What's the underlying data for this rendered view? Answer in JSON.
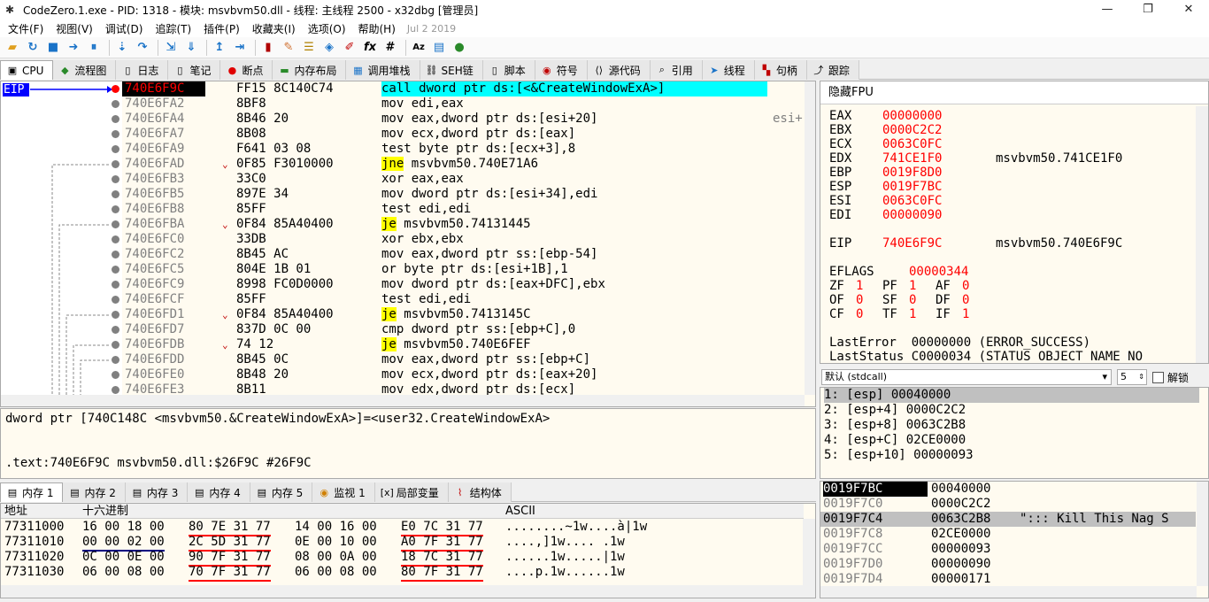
{
  "window": {
    "title": "CodeZero.1.exe - PID: 1318 - 模块: msvbvm50.dll - 线程: 主线程 2500 - x32dbg [管理员]",
    "min": "—",
    "max": "❐",
    "close": "✕"
  },
  "menu": [
    "文件(F)",
    "视图(V)",
    "调试(D)",
    "追踪(T)",
    "插件(P)",
    "收藏夹(I)",
    "选项(O)",
    "帮助(H)"
  ],
  "menu_date": "Jul 2 2019",
  "tabs": [
    {
      "label": "CPU",
      "icon": "cpu-icon"
    },
    {
      "label": "流程图",
      "icon": "graph-icon"
    },
    {
      "label": "日志",
      "icon": "log-icon"
    },
    {
      "label": "笔记",
      "icon": "notes-icon"
    },
    {
      "label": "断点",
      "icon": "breakpoint-icon"
    },
    {
      "label": "内存布局",
      "icon": "memory-map-icon"
    },
    {
      "label": "调用堆栈",
      "icon": "callstack-icon"
    },
    {
      "label": "SEH链",
      "icon": "seh-icon"
    },
    {
      "label": "脚本",
      "icon": "script-icon"
    },
    {
      "label": "符号",
      "icon": "symbol-icon"
    },
    {
      "label": "源代码",
      "icon": "source-icon"
    },
    {
      "label": "引用",
      "icon": "references-icon"
    },
    {
      "label": "线程",
      "icon": "threads-icon"
    },
    {
      "label": "句柄",
      "icon": "handles-icon"
    },
    {
      "label": "跟踪",
      "icon": "trace-icon"
    }
  ],
  "eip_label": "EIP",
  "disasm": [
    {
      "addr": "740E6F9C",
      "bytes": "FF15 8C140C74",
      "mn": "call",
      "ops": " dword ptr ds:[<&CreateWindowExA>]",
      "cur": true
    },
    {
      "addr": "740E6FA2",
      "bytes": "8BF8",
      "mn": "mov",
      "ops": " edi,eax"
    },
    {
      "addr": "740E6FA4",
      "bytes": "8B46 20",
      "mn": "mov",
      "ops": " eax,dword ptr ds:[esi+20]"
    },
    {
      "addr": "740E6FA7",
      "bytes": "8B08",
      "mn": "mov",
      "ops": " ecx,dword ptr ds:[eax]"
    },
    {
      "addr": "740E6FA9",
      "bytes": "F641 03 08",
      "mn": "test",
      "ops": " byte ptr ds:[ecx+3],8"
    },
    {
      "addr": "740E6FAD",
      "bytes": "0F85 F3010000",
      "mn": "jne",
      "ops": " msvbvm50.740E71A6",
      "jmp": true
    },
    {
      "addr": "740E6FB3",
      "bytes": "33C0",
      "mn": "xor",
      "ops": " eax,eax"
    },
    {
      "addr": "740E6FB5",
      "bytes": "897E 34",
      "mn": "mov",
      "ops": " dword ptr ds:[esi+34],edi"
    },
    {
      "addr": "740E6FB8",
      "bytes": "85FF",
      "mn": "test",
      "ops": " edi,edi"
    },
    {
      "addr": "740E6FBA",
      "bytes": "0F84 85A40400",
      "mn": "je",
      "ops": " msvbvm50.74131445",
      "jmp": true
    },
    {
      "addr": "740E6FC0",
      "bytes": "33DB",
      "mn": "xor",
      "ops": " ebx,ebx"
    },
    {
      "addr": "740E6FC2",
      "bytes": "8B45 AC",
      "mn": "mov",
      "ops": " eax,dword ptr ss:[ebp-54]"
    },
    {
      "addr": "740E6FC5",
      "bytes": "804E 1B 01",
      "mn": "or",
      "ops": " byte ptr ds:[esi+1B],1"
    },
    {
      "addr": "740E6FC9",
      "bytes": "8998 FC0D0000",
      "mn": "mov",
      "ops": " dword ptr ds:[eax+DFC],ebx"
    },
    {
      "addr": "740E6FCF",
      "bytes": "85FF",
      "mn": "test",
      "ops": " edi,edi"
    },
    {
      "addr": "740E6FD1",
      "bytes": "0F84 85A40400",
      "mn": "je",
      "ops": " msvbvm50.7413145C",
      "jmp": true
    },
    {
      "addr": "740E6FD7",
      "bytes": "837D 0C 00",
      "mn": "cmp",
      "ops": " dword ptr ss:[ebp+C],0"
    },
    {
      "addr": "740E6FDB",
      "bytes": "74 12",
      "mn": "je",
      "ops": " msvbvm50.740E6FEF",
      "jmp": true
    },
    {
      "addr": "740E6FDD",
      "bytes": "8B45 0C",
      "mn": "mov",
      "ops": " eax,dword ptr ss:[ebp+C]"
    },
    {
      "addr": "740E6FE0",
      "bytes": "8B48 20",
      "mn": "mov",
      "ops": " ecx,dword ptr ds:[eax+20]"
    },
    {
      "addr": "740E6FE3",
      "bytes": "8B11",
      "mn": "mov",
      "ops": " edx,dword ptr ds:[ecx]"
    }
  ],
  "disasm_side_comment": "esi+",
  "info": {
    "line1": "dword ptr [740C148C <msvbvm50.&CreateWindowExA>]=<user32.CreateWindowExA>",
    "line2": ".text:740E6F9C msvbvm50.dll:$26F9C #26F9C"
  },
  "regs": {
    "header": "隐藏FPU",
    "gp": [
      {
        "n": "EAX",
        "v": "00000000",
        "c": ""
      },
      {
        "n": "EBX",
        "v": "0000C2C2",
        "c": ""
      },
      {
        "n": "ECX",
        "v": "0063C0FC",
        "c": ""
      },
      {
        "n": "EDX",
        "v": "741CE1F0",
        "c": "msvbvm50.741CE1F0"
      },
      {
        "n": "EBP",
        "v": "0019F8D0",
        "c": ""
      },
      {
        "n": "ESP",
        "v": "0019F7BC",
        "c": ""
      },
      {
        "n": "ESI",
        "v": "0063C0FC",
        "c": ""
      },
      {
        "n": "EDI",
        "v": "00000090",
        "c": ""
      }
    ],
    "eip": {
      "n": "EIP",
      "v": "740E6F9C",
      "c": "msvbvm50.740E6F9C"
    },
    "eflags": {
      "n": "EFLAGS",
      "v": "00000344"
    },
    "flags": [
      [
        {
          "n": "ZF",
          "v": "1"
        },
        {
          "n": "PF",
          "v": "1"
        },
        {
          "n": "AF",
          "v": "0"
        }
      ],
      [
        {
          "n": "OF",
          "v": "0"
        },
        {
          "n": "SF",
          "v": "0"
        },
        {
          "n": "DF",
          "v": "0"
        }
      ],
      [
        {
          "n": "CF",
          "v": "0"
        },
        {
          "n": "TF",
          "v": "1"
        },
        {
          "n": "IF",
          "v": "1"
        }
      ]
    ],
    "lasterror": "LastError  00000000 (ERROR_SUCCESS)",
    "laststatus": "LastStatus C0000034 (STATUS_OBJECT_NAME_NO"
  },
  "callconv": {
    "value": "默认 (stdcall)",
    "count": "5",
    "unlock_label": "解锁"
  },
  "args": [
    "1: [esp] 00040000",
    "2: [esp+4] 0000C2C2",
    "3: [esp+8] 0063C2B8",
    "4: [esp+C] 02CE0000",
    "5: [esp+10] 00000093"
  ],
  "memtabs": [
    {
      "label": "内存 1",
      "icon": "dump-icon"
    },
    {
      "label": "内存 2",
      "icon": "dump-icon"
    },
    {
      "label": "内存 3",
      "icon": "dump-icon"
    },
    {
      "label": "内存 4",
      "icon": "dump-icon"
    },
    {
      "label": "内存 5",
      "icon": "dump-icon"
    },
    {
      "label": "监视 1",
      "icon": "watch-icon"
    },
    {
      "label": "局部变量",
      "icon": "locals-icon"
    },
    {
      "label": "结构体",
      "icon": "struct-icon"
    }
  ],
  "dump": {
    "headers": {
      "addr": "地址",
      "hex": "十六进制",
      "ascii": "ASCII"
    },
    "rows": [
      {
        "addr": "77311000",
        "g": [
          "16 00 18 00",
          "80 7E 31 77",
          "14 00 16 00",
          "E0 7C 31 77"
        ],
        "ascii": "........~1w....à|1w"
      },
      {
        "addr": "77311010",
        "g": [
          "00 00 02 00",
          "2C 5D 31 77",
          "0E 00 10 00",
          "A0 7F 31 77"
        ],
        "ascii": "....,]1w.... .1w"
      },
      {
        "addr": "77311020",
        "g": [
          "0C 00 0E 00",
          "90 7F 31 77",
          "08 00 0A 00",
          "18 7C 31 77"
        ],
        "ascii": "......1w.....|1w"
      },
      {
        "addr": "77311030",
        "g": [
          "06 00 08 00",
          "70 7F 31 77",
          "06 00 08 00",
          "80 7F 31 77"
        ],
        "ascii": "....p.1w......1w"
      }
    ]
  },
  "stack": [
    {
      "a": "0019F7BC",
      "v": "00040000",
      "c": "",
      "top": true
    },
    {
      "a": "0019F7C0",
      "v": "0000C2C2",
      "c": ""
    },
    {
      "a": "0019F7C4",
      "v": "0063C2B8",
      "c": "\"::: Kill This Nag S",
      "sel": true
    },
    {
      "a": "0019F7C8",
      "v": "02CE0000",
      "c": ""
    },
    {
      "a": "0019F7CC",
      "v": "00000093",
      "c": ""
    },
    {
      "a": "0019F7D0",
      "v": "00000090",
      "c": ""
    },
    {
      "a": "0019F7D4",
      "v": "00000171",
      "c": ""
    }
  ]
}
